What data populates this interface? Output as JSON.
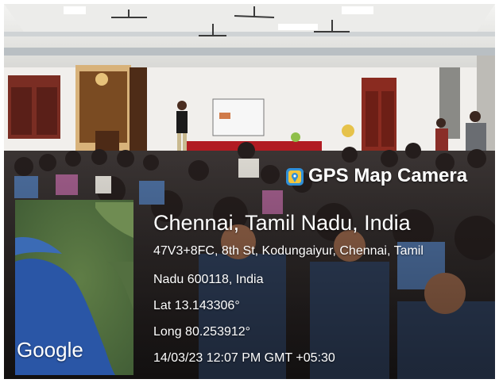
{
  "overlay": {
    "brand": "GPS Map Camera",
    "brand_icon": "gps-map-camera-icon",
    "city": "Chennai, Tamil Nadu, India",
    "address_line1": "47V3+8FC, 8th St, Kodungaiyur, Chennai, Tamil",
    "address_line2": "Nadu 600118, India",
    "lat": "Lat 13.143306°",
    "long": "Long 80.253912°",
    "timestamp": "14/03/23 12:07 PM GMT +05:30"
  },
  "map": {
    "logo": "Google"
  }
}
